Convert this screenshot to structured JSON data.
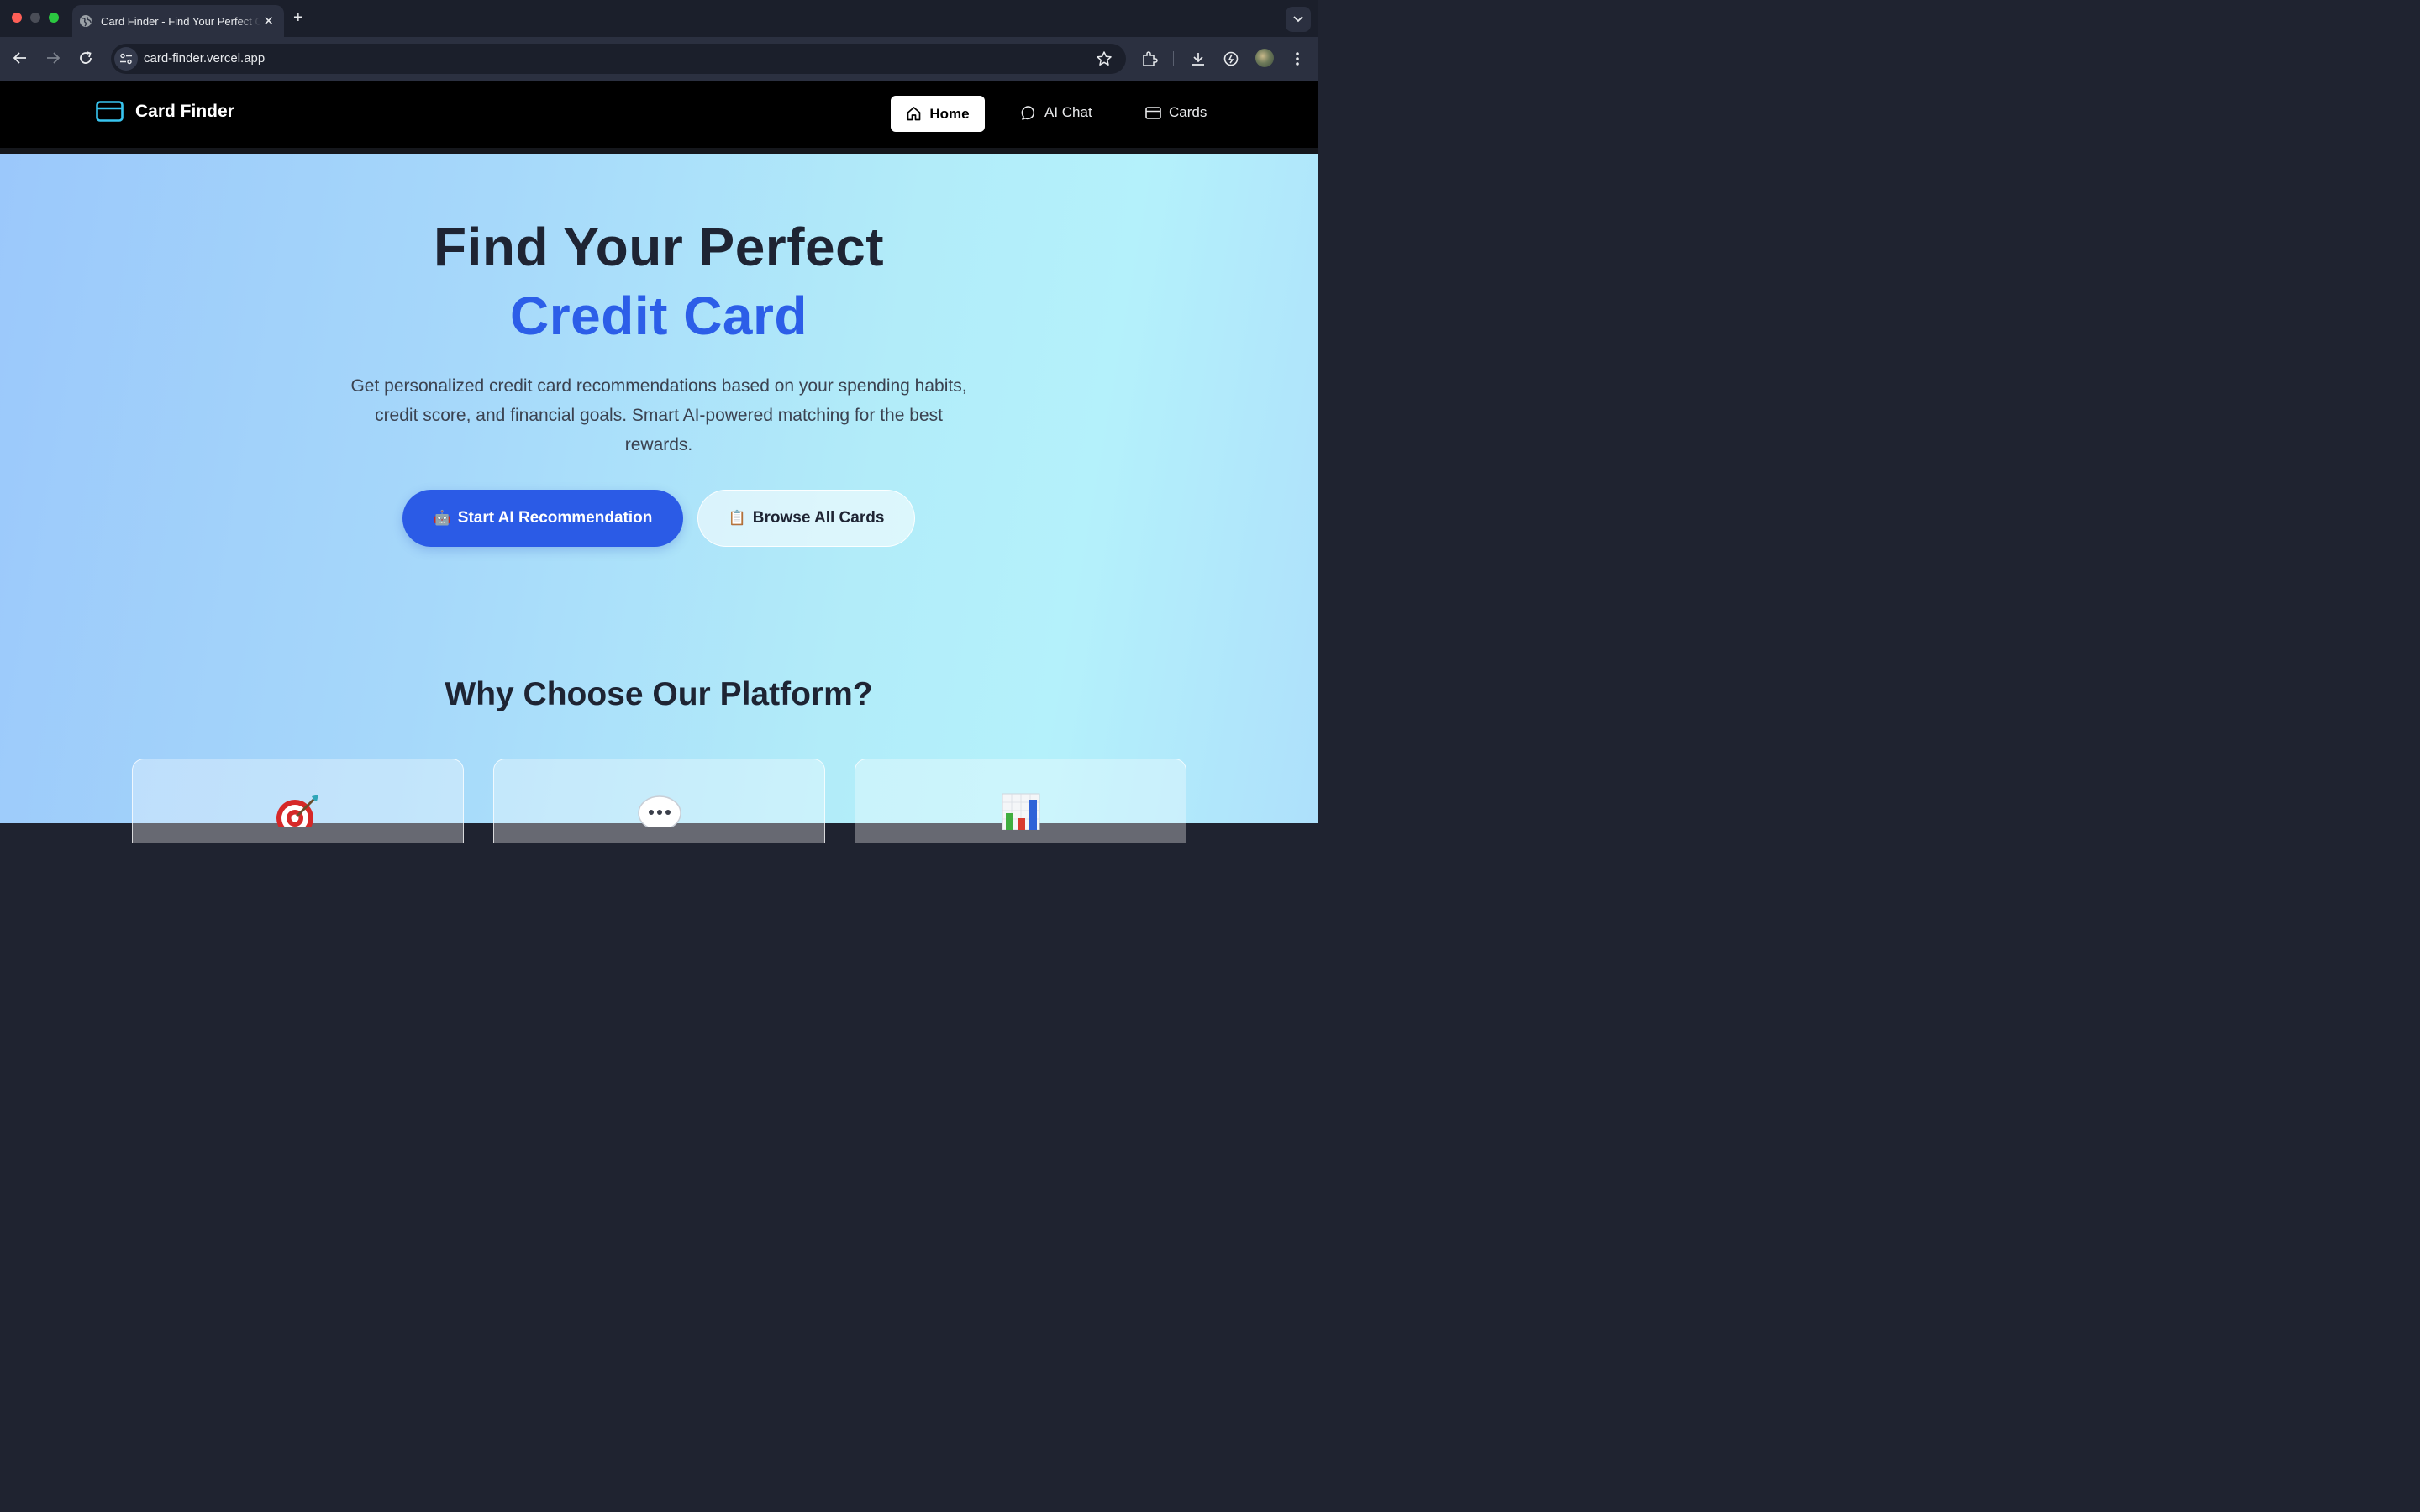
{
  "browser": {
    "tab_title": "Card Finder - Find Your Perfect Credit Card",
    "tab_close": "✕",
    "new_tab": "+",
    "url": "card-finder.vercel.app"
  },
  "header": {
    "brand": "Card Finder",
    "nav": {
      "home": "Home",
      "ai_chat": "AI Chat",
      "cards": "Cards"
    }
  },
  "hero": {
    "title_line1": "Find Your Perfect",
    "title_line2": "Credit Card",
    "description": "Get personalized credit card recommendations based on your spending habits, credit score, and financial goals. Smart AI-powered matching for the best rewards.",
    "primary_cta": {
      "emoji": "🤖",
      "label": "Start AI Recommendation"
    },
    "secondary_cta": {
      "emoji": "📋",
      "label": "Browse All Cards"
    }
  },
  "features": {
    "title": "Why Choose Our Platform?",
    "cards": [
      {
        "icon": "target-icon"
      },
      {
        "icon": "speech-bubble-icon"
      },
      {
        "icon": "bar-chart-icon"
      }
    ]
  },
  "colors": {
    "accent_blue": "#2c5ee8",
    "header_bg": "#000000",
    "brand_icon": "#38c5f0",
    "heading_dark": "#1e2433"
  }
}
